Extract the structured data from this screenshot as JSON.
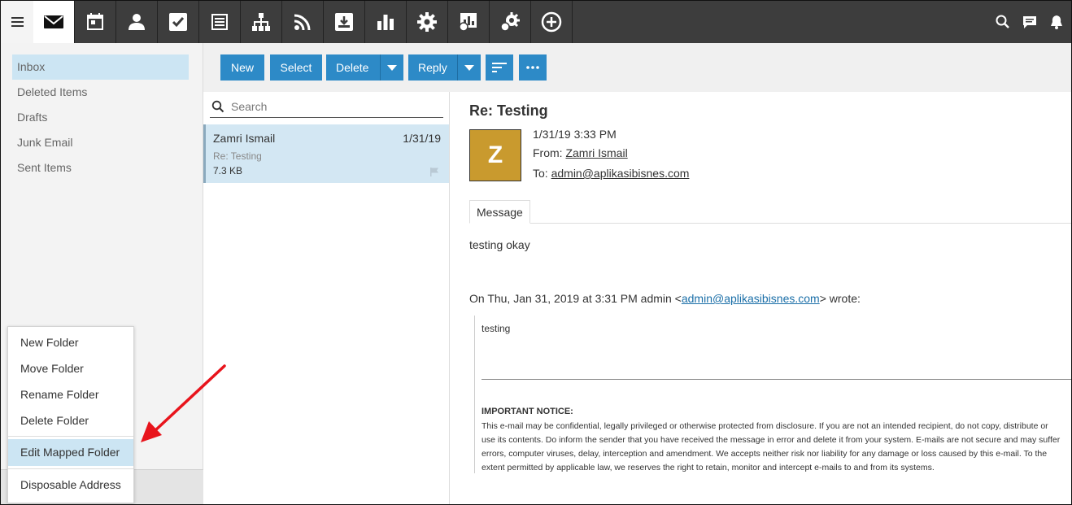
{
  "topbar": {
    "apps": [
      {
        "icon": "mail-icon",
        "active": true
      },
      {
        "icon": "calendar-icon"
      },
      {
        "icon": "contacts-icon"
      },
      {
        "icon": "tasks-icon"
      },
      {
        "icon": "notes-icon"
      },
      {
        "icon": "sitemap-icon"
      },
      {
        "icon": "rss-icon"
      },
      {
        "icon": "download-box-icon"
      },
      {
        "icon": "bar-chart-icon"
      },
      {
        "icon": "gear-icon"
      },
      {
        "icon": "domain-report-icon"
      },
      {
        "icon": "domain-settings-icon"
      },
      {
        "icon": "plus-circle-icon"
      }
    ],
    "right_icons": [
      "search-icon",
      "chat-icon",
      "bell-icon"
    ]
  },
  "sidebar": {
    "folders": [
      {
        "label": "Inbox",
        "selected": true
      },
      {
        "label": "Deleted Items"
      },
      {
        "label": "Drafts"
      },
      {
        "label": "Junk Email"
      },
      {
        "label": "Sent Items"
      }
    ]
  },
  "context_menu": {
    "items": [
      {
        "label": "New Folder"
      },
      {
        "label": "Move Folder"
      },
      {
        "label": "Rename Folder"
      },
      {
        "label": "Delete Folder"
      },
      {
        "label": "Edit Mapped Folder",
        "highlighted": true
      },
      {
        "label": "Disposable Address"
      }
    ]
  },
  "toolbar": {
    "new_label": "New",
    "select_label": "Select",
    "delete_label": "Delete",
    "reply_label": "Reply",
    "accent": "#2d8ac7"
  },
  "search": {
    "placeholder": "Search"
  },
  "message_list": [
    {
      "from": "Zamri Ismail",
      "date": "1/31/19",
      "subject": "Re: Testing",
      "size": "7.3 KB"
    }
  ],
  "reading_pane": {
    "subject": "Re: Testing",
    "avatar_letter": "Z",
    "avatar_color": "#c99a2e",
    "datetime": "1/31/19 3:33 PM",
    "from_label": "From:",
    "from_name": "Zamri Ismail",
    "to_label": "To:",
    "to_address": "admin@aplikasibisnes.com",
    "tab_label": "Message",
    "body_first": "testing okay",
    "quote_intro_prefix": "On Thu, Jan 31, 2019 at 3:31 PM admin <",
    "quote_intro_email": "admin@aplikasibisnes.com",
    "quote_intro_suffix": "> wrote:",
    "quoted_text": "testing",
    "notice_title": "IMPORTANT NOTICE:",
    "notice_lines": [
      "This e-mail may be confidential, legally privileged or otherwise protected from disclosure. If you are not an intended recipient, do not copy, distribute or",
      "use its contents. Do inform the sender that you have received the message in error and delete it from your system. E-mails are not secure and may suffer",
      "errors, computer viruses, delay, interception and amendment. We accepts neither risk nor liability for any damage or loss caused by this e-mail. To the",
      "extent permitted by applicable law, we reserves the right to retain, monitor and intercept e-mails to and from its systems."
    ]
  }
}
